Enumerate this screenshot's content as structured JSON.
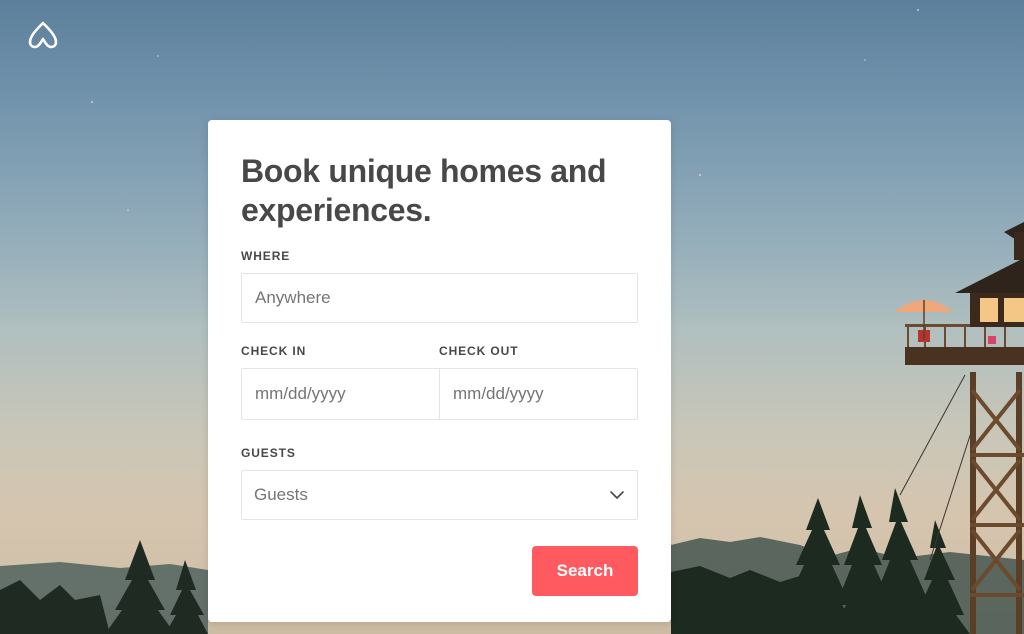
{
  "brand": {
    "logo_icon": "airbnb-belo-icon",
    "accent_color": "#ff5a5f"
  },
  "search_card": {
    "title": "Book unique homes and experiences.",
    "where": {
      "label": "WHERE",
      "placeholder": "Anywhere"
    },
    "check_in": {
      "label": "CHECK IN",
      "placeholder": "mm/dd/yyyy"
    },
    "check_out": {
      "label": "CHECK OUT",
      "placeholder": "mm/dd/yyyy"
    },
    "guests": {
      "label": "GUESTS",
      "value": "Guests",
      "icon": "chevron-down-icon"
    },
    "search_button_label": "Search"
  }
}
